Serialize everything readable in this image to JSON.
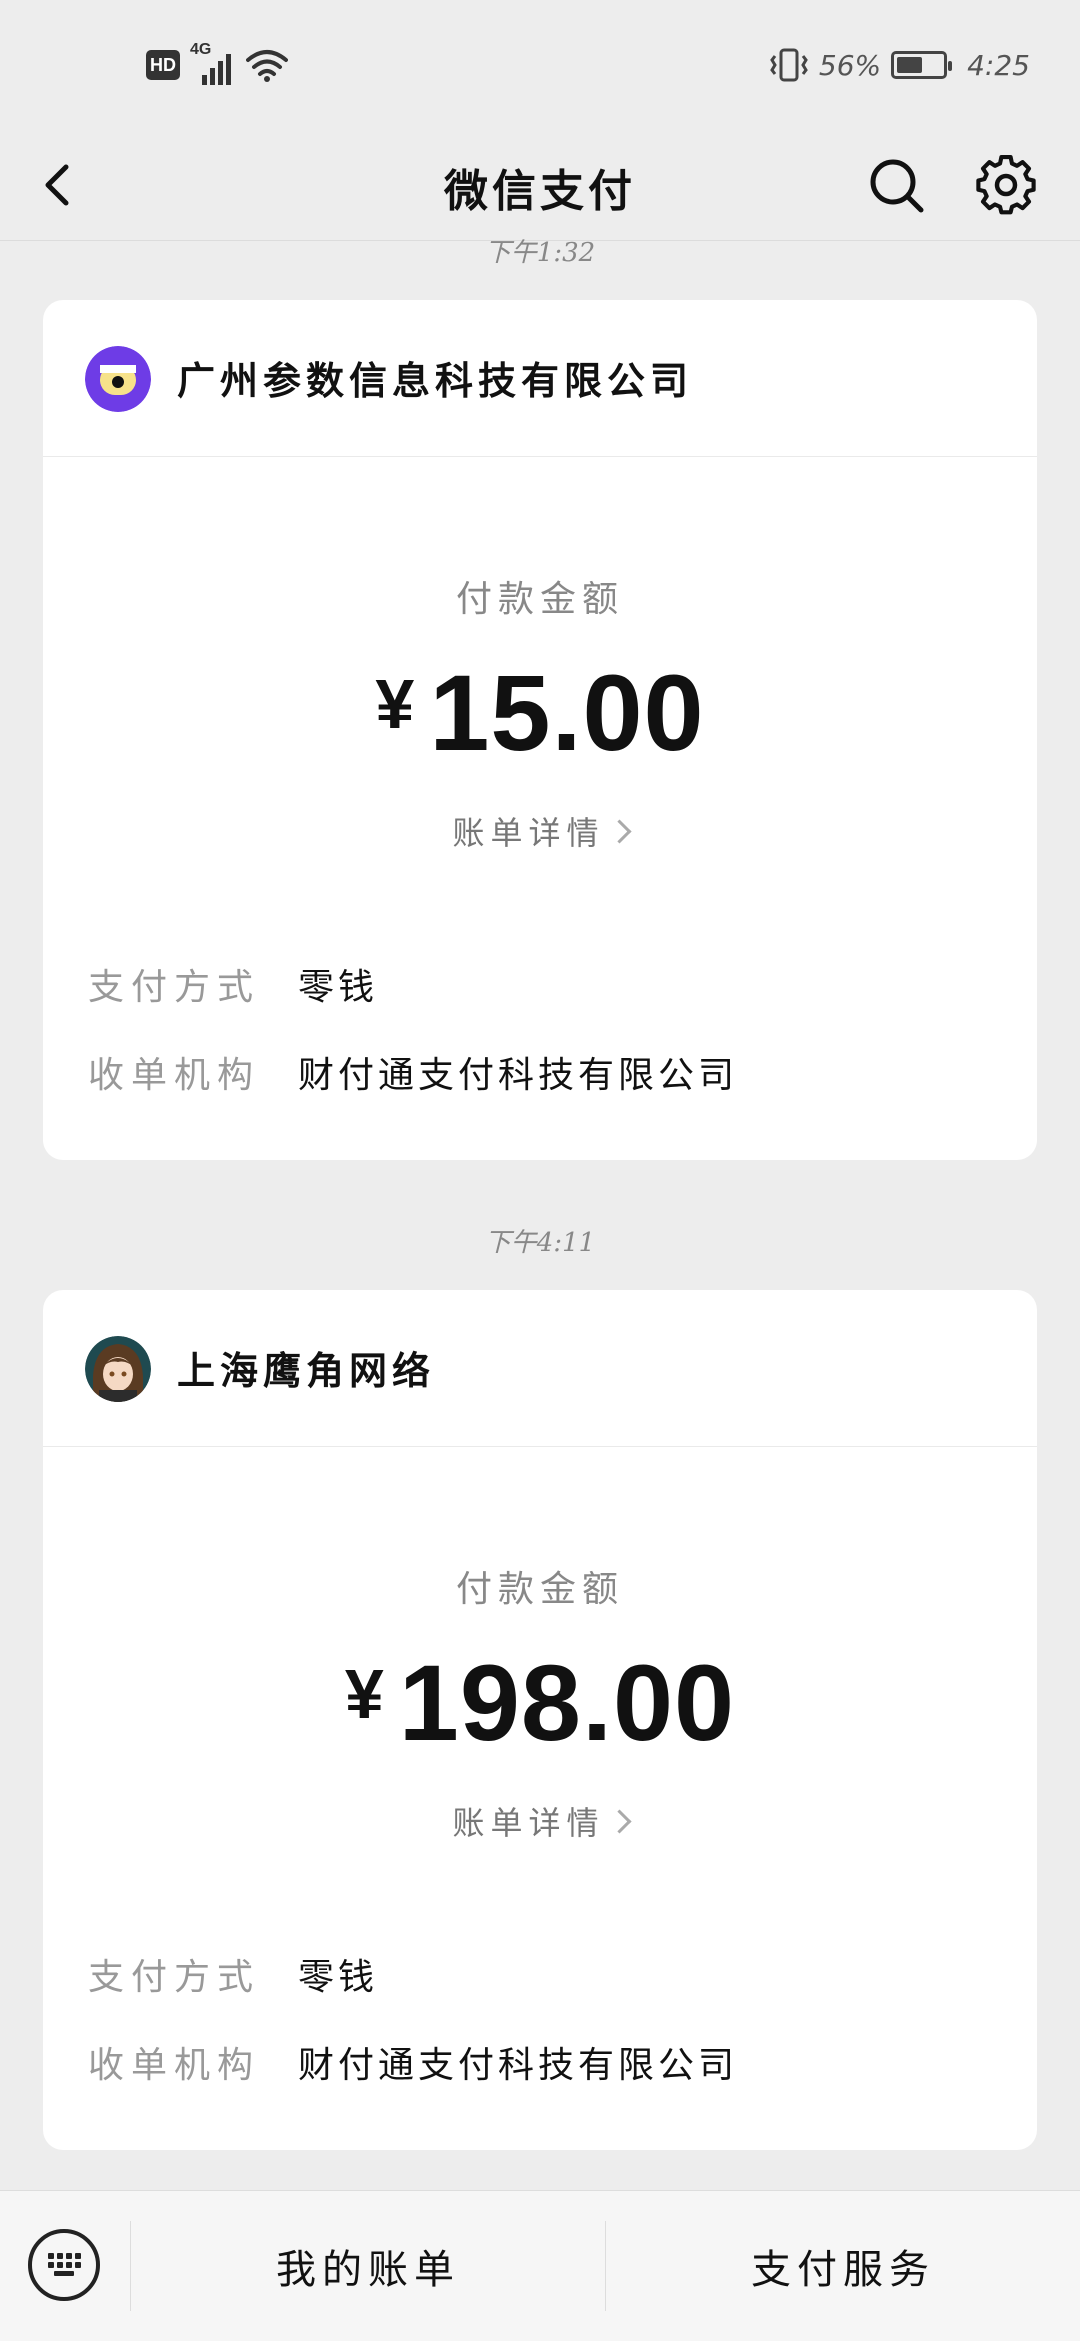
{
  "status_bar": {
    "hd_label": "HD",
    "network_label": "4G",
    "battery_percent": "56%",
    "battery_level": 0.56,
    "time": "4:25"
  },
  "header": {
    "title": "微信支付",
    "back_icon": "chevron-left-icon",
    "search_icon": "search-icon",
    "settings_icon": "gear-icon"
  },
  "payments": [
    {
      "timestamp": "下午1:32",
      "merchant": "广州参数信息科技有限公司",
      "amount_label": "付款金额",
      "currency": "¥",
      "amount": "15.00",
      "detail_link": "账单详情",
      "fields": [
        {
          "key": "支付方式",
          "value": "零钱"
        },
        {
          "key": "收单机构",
          "value": "财付通支付科技有限公司"
        }
      ]
    },
    {
      "timestamp": "下午4:11",
      "merchant": "上海鹰角网络",
      "amount_label": "付款金额",
      "currency": "¥",
      "amount": "198.00",
      "detail_link": "账单详情",
      "fields": [
        {
          "key": "支付方式",
          "value": "零钱"
        },
        {
          "key": "收单机构",
          "value": "财付通支付科技有限公司"
        }
      ]
    }
  ],
  "bottom_bar": {
    "keyboard_icon": "keyboard-icon",
    "my_bills": "我的账单",
    "pay_services": "支付服务"
  },
  "colors": {
    "background": "#ededed",
    "card": "#ffffff",
    "merchant1_logo": "#6e3ce6",
    "text_secondary": "#888888"
  }
}
